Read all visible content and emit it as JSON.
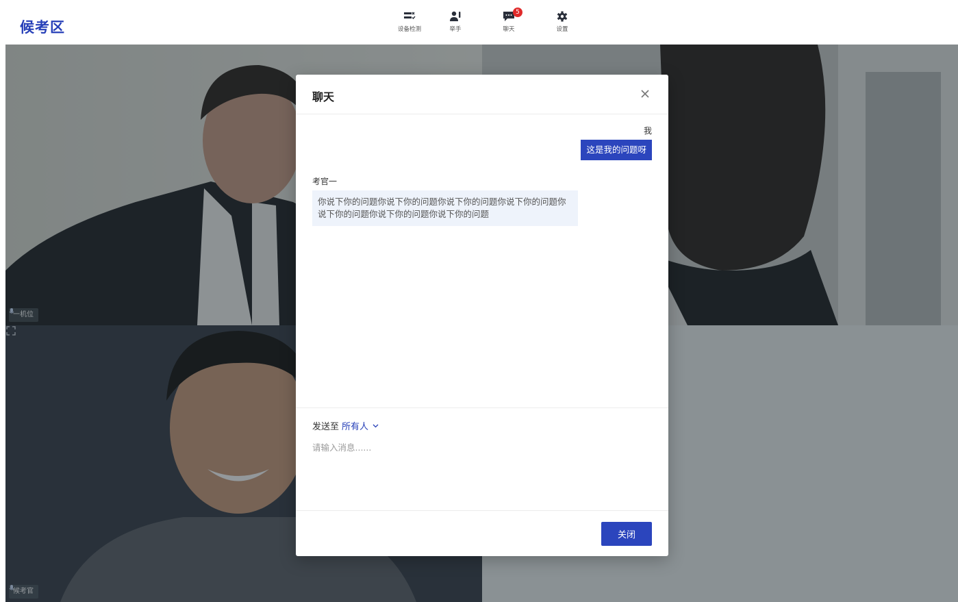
{
  "header": {
    "title": "候考区",
    "tools": [
      {
        "label": "设备检测",
        "icon": "device-check-icon"
      },
      {
        "label": "举手",
        "icon": "raise-hand-icon"
      },
      {
        "label": "聊天",
        "icon": "chat-icon",
        "badge": "5"
      },
      {
        "label": "设置",
        "icon": "gear-icon"
      }
    ]
  },
  "videos": {
    "tile1_label": "一机位",
    "tile3_label": "候考官"
  },
  "chat": {
    "title": "聊天",
    "messages": [
      {
        "sender": "我",
        "text": "这是我的问题呀"
      },
      {
        "sender": "考官一",
        "text": "你说下你的问题你说下你的问题你说下你的问题你说下你的问题你说下你的问题你说下你的问题你说下你的问题"
      }
    ],
    "send_to_label": "发送至",
    "send_to_target": "所有人",
    "input_placeholder": "请输入消息......",
    "close_label": "关闭"
  },
  "colors": {
    "accent": "#2b45bd",
    "title": "#2740b8",
    "badge": "#e02a2a",
    "bubble_other": "#eef3fb"
  }
}
